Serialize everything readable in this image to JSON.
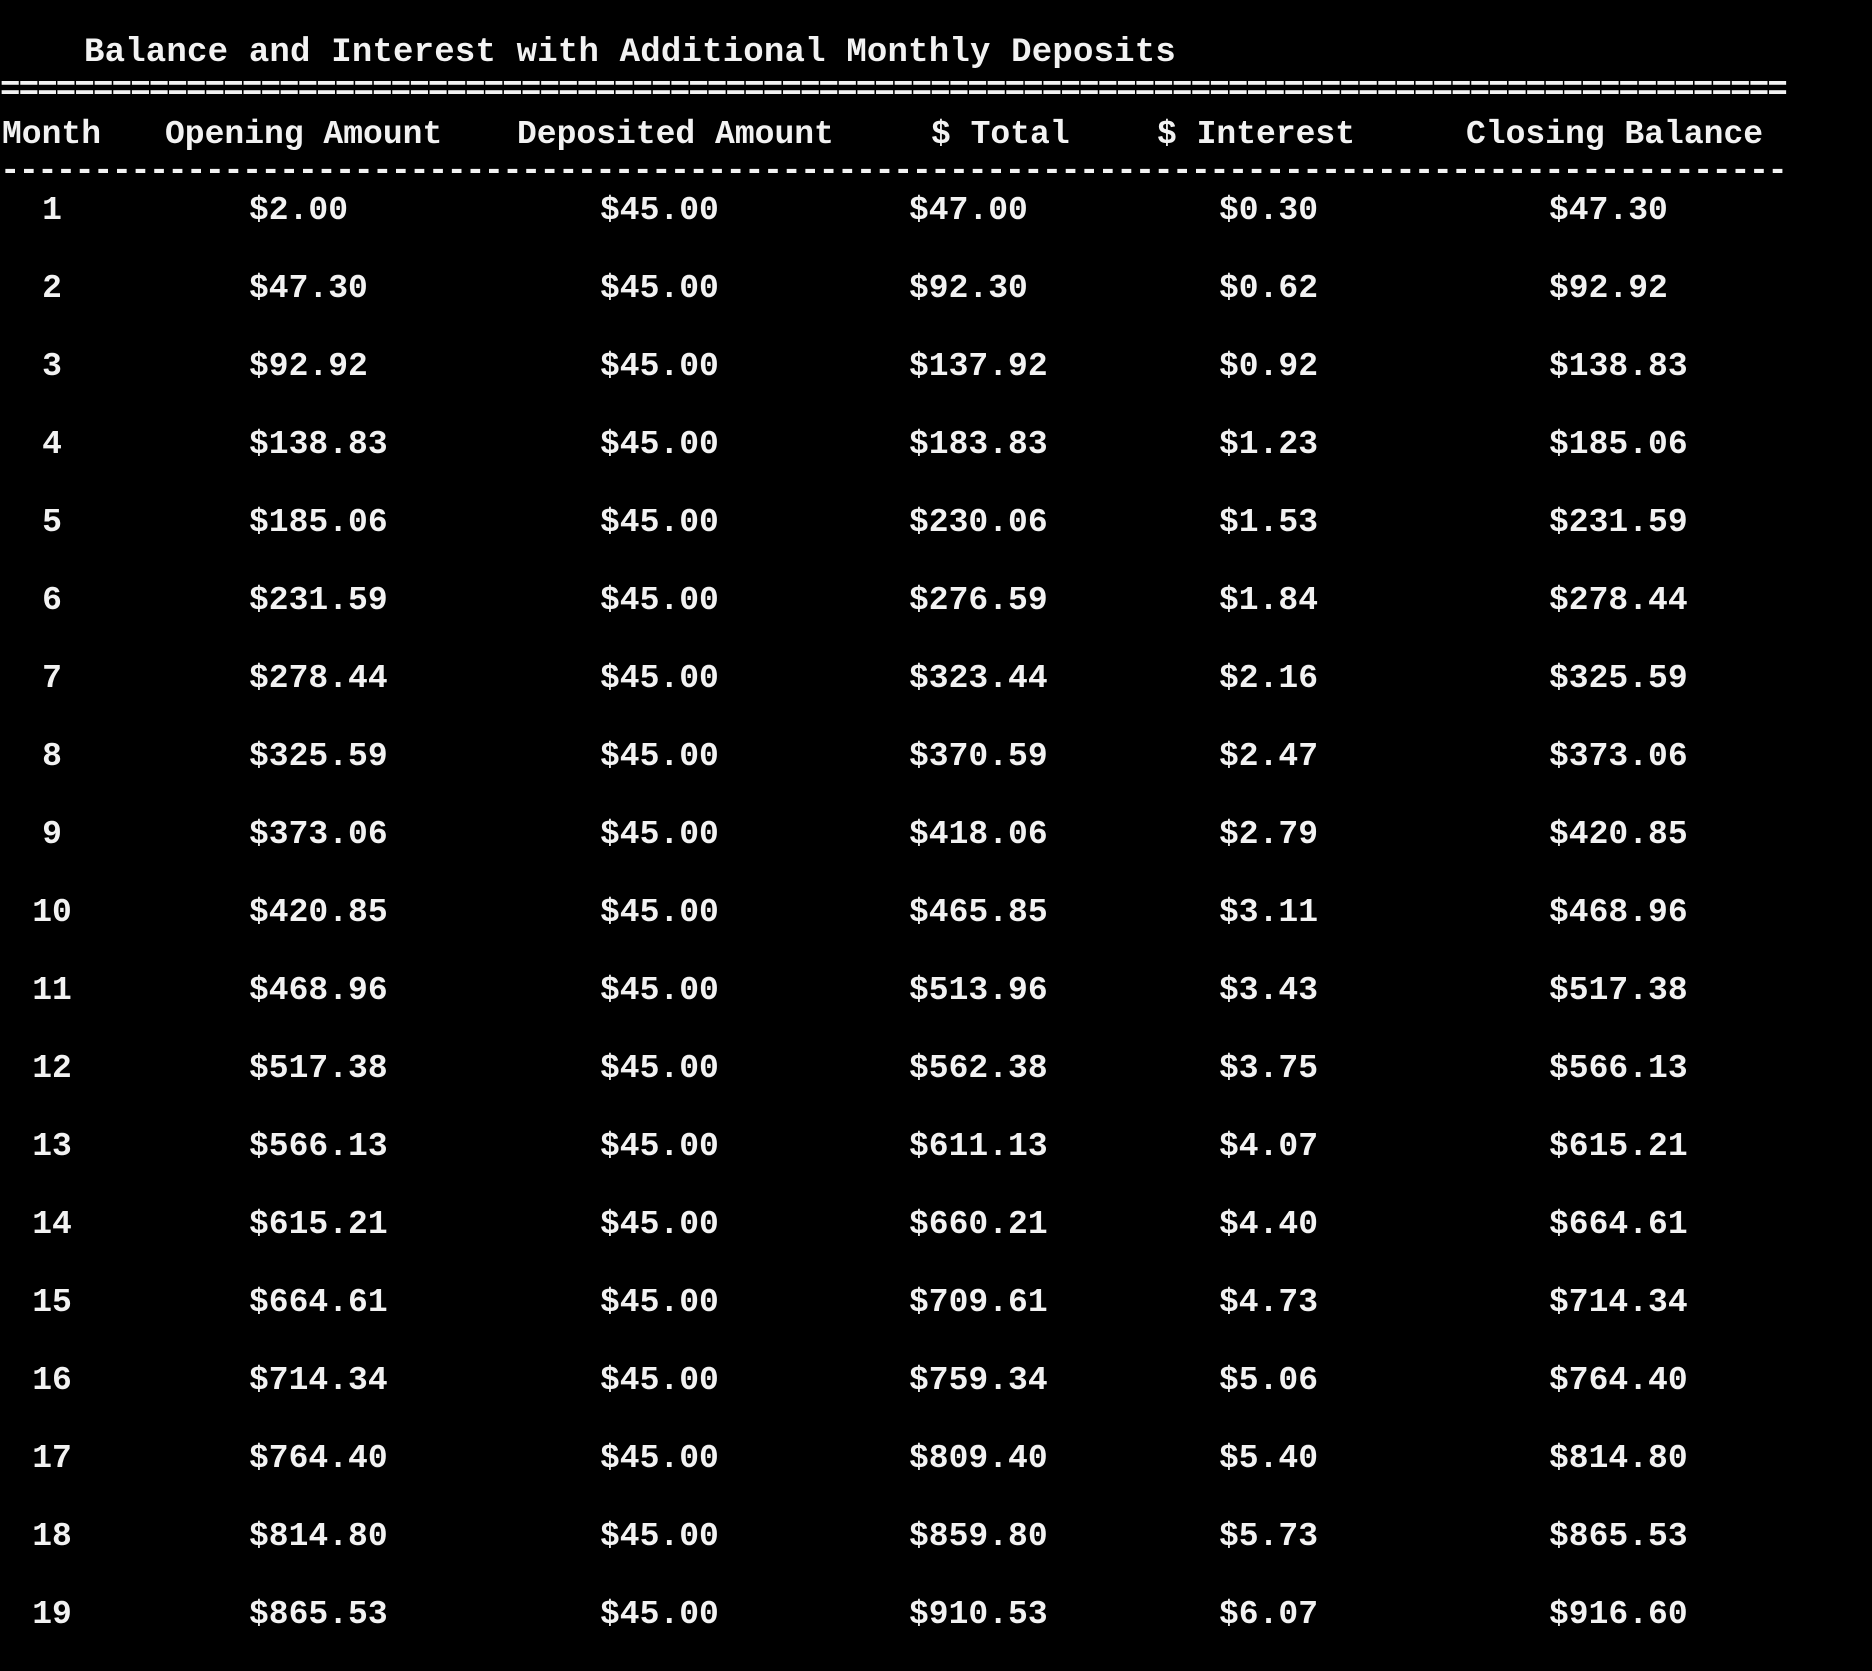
{
  "title": "Balance and Interest with Additional Monthly Deposits",
  "rule_double": "================================================================================================",
  "rule_single": "------------------------------------------------------------------------------------------------",
  "headers": {
    "month": "Month",
    "opening": "Opening Amount",
    "deposited": "Deposited Amount",
    "total": "$ Total",
    "interest": "$ Interest",
    "closing": "Closing Balance"
  },
  "rows": [
    {
      "month": "1",
      "opening": "$2.00",
      "deposited": "$45.00",
      "total": "$47.00",
      "interest": "$0.30",
      "closing": "$47.30"
    },
    {
      "month": "2",
      "opening": "$47.30",
      "deposited": "$45.00",
      "total": "$92.30",
      "interest": "$0.62",
      "closing": "$92.92"
    },
    {
      "month": "3",
      "opening": "$92.92",
      "deposited": "$45.00",
      "total": "$137.92",
      "interest": "$0.92",
      "closing": "$138.83"
    },
    {
      "month": "4",
      "opening": "$138.83",
      "deposited": "$45.00",
      "total": "$183.83",
      "interest": "$1.23",
      "closing": "$185.06"
    },
    {
      "month": "5",
      "opening": "$185.06",
      "deposited": "$45.00",
      "total": "$230.06",
      "interest": "$1.53",
      "closing": "$231.59"
    },
    {
      "month": "6",
      "opening": "$231.59",
      "deposited": "$45.00",
      "total": "$276.59",
      "interest": "$1.84",
      "closing": "$278.44"
    },
    {
      "month": "7",
      "opening": "$278.44",
      "deposited": "$45.00",
      "total": "$323.44",
      "interest": "$2.16",
      "closing": "$325.59"
    },
    {
      "month": "8",
      "opening": "$325.59",
      "deposited": "$45.00",
      "total": "$370.59",
      "interest": "$2.47",
      "closing": "$373.06"
    },
    {
      "month": "9",
      "opening": "$373.06",
      "deposited": "$45.00",
      "total": "$418.06",
      "interest": "$2.79",
      "closing": "$420.85"
    },
    {
      "month": "10",
      "opening": "$420.85",
      "deposited": "$45.00",
      "total": "$465.85",
      "interest": "$3.11",
      "closing": "$468.96"
    },
    {
      "month": "11",
      "opening": "$468.96",
      "deposited": "$45.00",
      "total": "$513.96",
      "interest": "$3.43",
      "closing": "$517.38"
    },
    {
      "month": "12",
      "opening": "$517.38",
      "deposited": "$45.00",
      "total": "$562.38",
      "interest": "$3.75",
      "closing": "$566.13"
    },
    {
      "month": "13",
      "opening": "$566.13",
      "deposited": "$45.00",
      "total": "$611.13",
      "interest": "$4.07",
      "closing": "$615.21"
    },
    {
      "month": "14",
      "opening": "$615.21",
      "deposited": "$45.00",
      "total": "$660.21",
      "interest": "$4.40",
      "closing": "$664.61"
    },
    {
      "month": "15",
      "opening": "$664.61",
      "deposited": "$45.00",
      "total": "$709.61",
      "interest": "$4.73",
      "closing": "$714.34"
    },
    {
      "month": "16",
      "opening": "$714.34",
      "deposited": "$45.00",
      "total": "$759.34",
      "interest": "$5.06",
      "closing": "$764.40"
    },
    {
      "month": "17",
      "opening": "$764.40",
      "deposited": "$45.00",
      "total": "$809.40",
      "interest": "$5.40",
      "closing": "$814.80"
    },
    {
      "month": "18",
      "opening": "$814.80",
      "deposited": "$45.00",
      "total": "$859.80",
      "interest": "$5.73",
      "closing": "$865.53"
    },
    {
      "month": "19",
      "opening": "$865.53",
      "deposited": "$45.00",
      "total": "$910.53",
      "interest": "$6.07",
      "closing": "$916.60"
    }
  ],
  "colors": {
    "background": "#000000",
    "text": "#f2f2f2"
  }
}
